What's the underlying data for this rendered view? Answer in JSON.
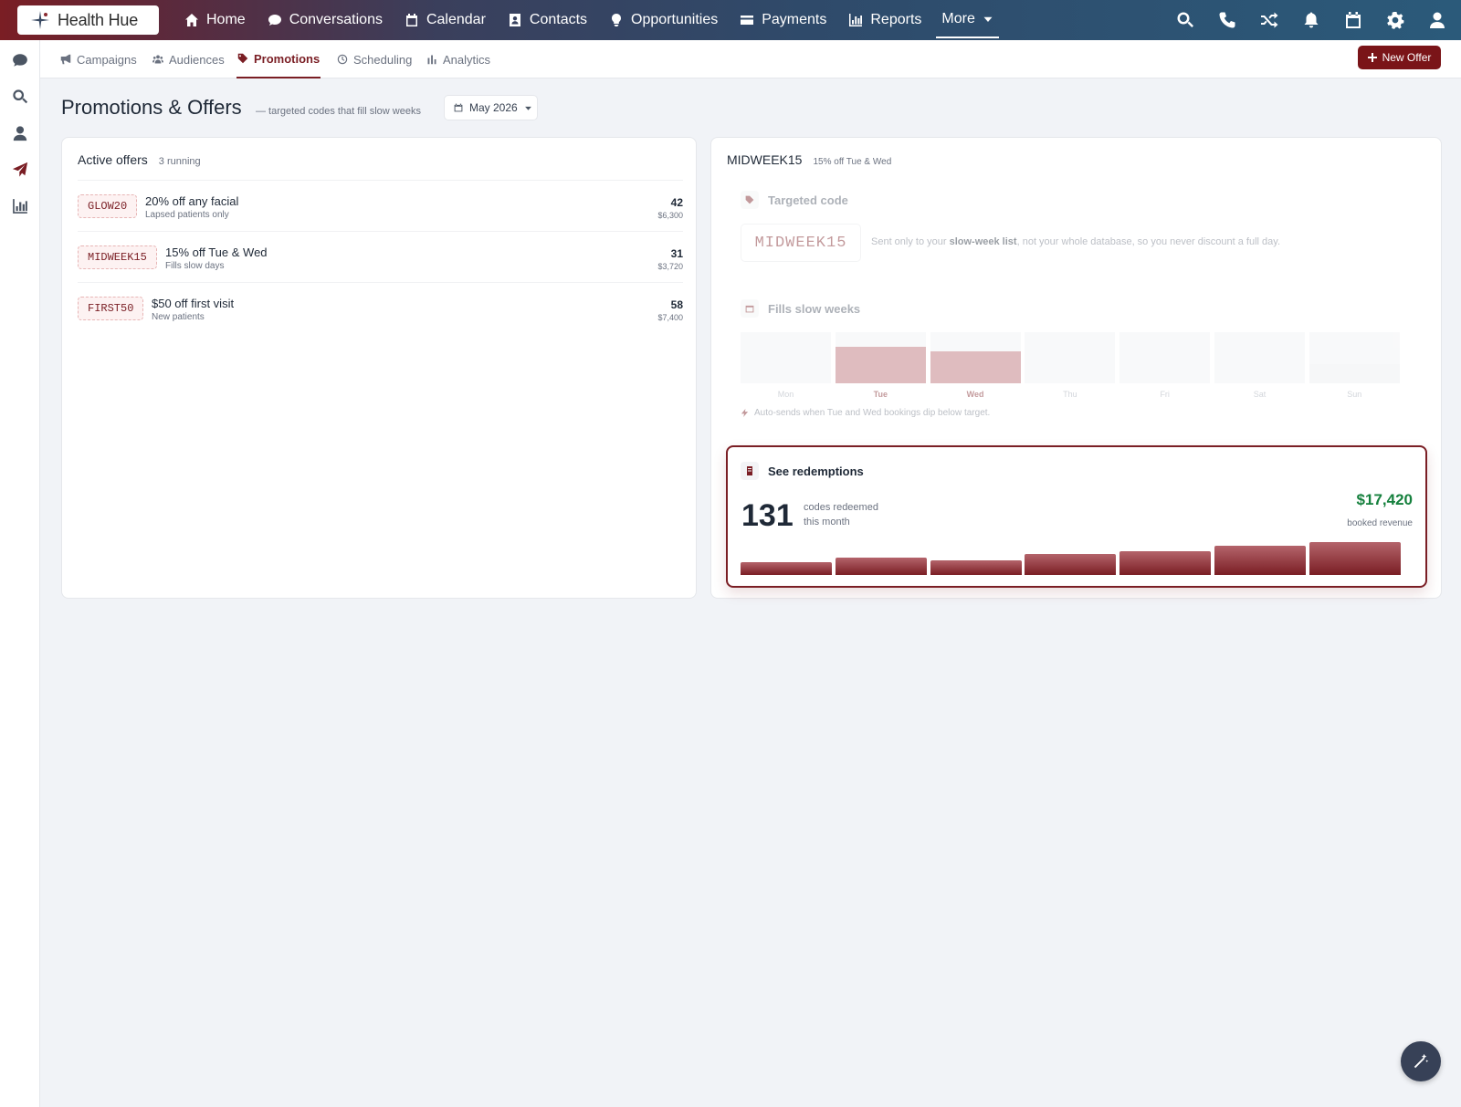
{
  "app": {
    "name": "Health Hue"
  },
  "nav": {
    "items": [
      {
        "label": "Home",
        "icon": "home-icon"
      },
      {
        "label": "Conversations",
        "icon": "chat-icon"
      },
      {
        "label": "Calendar",
        "icon": "calendar-icon"
      },
      {
        "label": "Contacts",
        "icon": "contact-card-icon"
      },
      {
        "label": "Opportunities",
        "icon": "lightbulb-icon"
      },
      {
        "label": "Payments",
        "icon": "credit-card-icon"
      },
      {
        "label": "Reports",
        "icon": "bar-chart-icon"
      }
    ],
    "more_label": "More",
    "right_icons": [
      "search-icon",
      "phone-icon",
      "shuffle-icon",
      "bell-icon",
      "calendar-icon",
      "gear-icon",
      "user-icon"
    ]
  },
  "rail": {
    "icons": [
      "chat-icon",
      "search-icon",
      "user-icon",
      "send-icon",
      "bar-chart-icon"
    ],
    "active": "send-icon"
  },
  "subnav": {
    "tabs": [
      {
        "label": "Campaigns",
        "icon": "megaphone-icon"
      },
      {
        "label": "Audiences",
        "icon": "users-icon"
      },
      {
        "label": "Promotions",
        "icon": "tag-icon"
      },
      {
        "label": "Scheduling",
        "icon": "clock-icon"
      },
      {
        "label": "Analytics",
        "icon": "bar-chart-icon"
      }
    ],
    "active": "Promotions",
    "new_offer_label": "New Offer"
  },
  "page": {
    "title": "Promotions & Offers",
    "subtitle": "— targeted codes that fill slow weeks",
    "month": "May 2026"
  },
  "offers": {
    "title": "Active offers",
    "meta": "3 running",
    "items": [
      {
        "code": "GLOW20",
        "name": "20% off any facial",
        "desc": "Lapsed patients only",
        "count": "42",
        "revenue": "$6,300"
      },
      {
        "code": "MIDWEEK15",
        "name": "15% off Tue & Wed",
        "desc": "Fills slow days",
        "count": "31",
        "revenue": "$3,720"
      },
      {
        "code": "FIRST50",
        "name": "$50 off first visit",
        "desc": "New patients",
        "count": "58",
        "revenue": "$7,400"
      }
    ]
  },
  "detail": {
    "title": "MIDWEEK15",
    "subtitle": "15% off Tue & Wed",
    "targeted": {
      "label": "Targeted code",
      "code": "MIDWEEK15",
      "note_before": "Sent only to your ",
      "note_bold": "slow-week list",
      "note_after": ", not your whole database, so you never discount a full day."
    },
    "slow_weeks": {
      "label": "Fills slow weeks",
      "days": [
        {
          "label": "Mon",
          "level": 0,
          "highlight": false
        },
        {
          "label": "Tue",
          "level": 0.72,
          "highlight": true
        },
        {
          "label": "Wed",
          "level": 0.62,
          "highlight": true
        },
        {
          "label": "Thu",
          "level": 0,
          "highlight": false
        },
        {
          "label": "Fri",
          "level": 0,
          "highlight": false
        },
        {
          "label": "Sat",
          "level": 0,
          "highlight": false
        },
        {
          "label": "Sun",
          "level": 0.38,
          "highlight": false
        }
      ],
      "note": "Auto-sends when Tue and Wed bookings dip below target."
    },
    "redemptions": {
      "label": "See redemptions",
      "count": "131",
      "count_label_1": "codes redeemed",
      "count_label_2": "this month",
      "revenue": "$17,420",
      "revenue_label": "booked revenue",
      "trend": [
        0.38,
        0.52,
        0.45,
        0.65,
        0.72,
        0.88,
        1.0
      ]
    }
  },
  "colors": {
    "brand": "#7a1e24",
    "accent_green": "#15803d"
  }
}
